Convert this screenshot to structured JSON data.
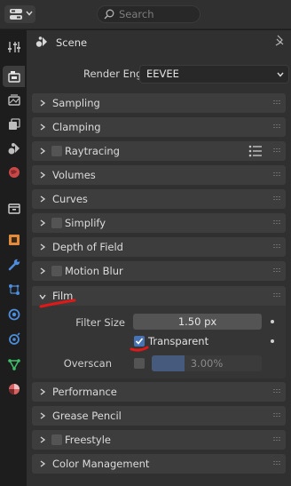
{
  "header": {
    "search_placeholder": "Search"
  },
  "tabs": [
    {
      "icon": "tool-icon",
      "active": false
    },
    {
      "icon": "render-icon",
      "active": true
    },
    {
      "icon": "output-icon",
      "active": false
    },
    {
      "icon": "view-layer-icon",
      "active": false
    },
    {
      "icon": "scene-icon",
      "active": false
    },
    {
      "icon": "world-icon",
      "active": false
    },
    {
      "icon": "collection-icon",
      "active": false
    },
    {
      "icon": "object-icon",
      "active": false
    },
    {
      "icon": "modifier-icon",
      "active": false
    },
    {
      "icon": "particles-icon",
      "active": false
    },
    {
      "icon": "physics-icon",
      "active": false
    },
    {
      "icon": "constraints-icon",
      "active": false
    },
    {
      "icon": "data-icon",
      "active": false
    },
    {
      "icon": "material-icon",
      "active": false
    }
  ],
  "context": {
    "title": "Scene"
  },
  "render_engine": {
    "label": "Render Engine",
    "value": "EEVEE"
  },
  "panels_top": [
    {
      "label": "Sampling",
      "has_checkbox": false
    },
    {
      "label": "Clamping",
      "has_checkbox": false
    },
    {
      "label": "Raytracing",
      "has_checkbox": true
    },
    {
      "label": "Volumes",
      "has_checkbox": false
    },
    {
      "label": "Curves",
      "has_checkbox": false
    },
    {
      "label": "Simplify",
      "has_checkbox": true
    },
    {
      "label": "Depth of Field",
      "has_checkbox": false
    },
    {
      "label": "Motion Blur",
      "has_checkbox": true
    }
  ],
  "film": {
    "label": "Film",
    "filter_size_label": "Filter Size",
    "filter_size_value": "1.50 px",
    "transparent_label": "Transparent",
    "transparent_checked": true,
    "overscan_label": "Overscan",
    "overscan_checked": false,
    "overscan_value": "3.00%",
    "overscan_fill_fraction": 0.3
  },
  "panels_bottom": [
    {
      "label": "Performance",
      "has_checkbox": false
    },
    {
      "label": "Grease Pencil",
      "has_checkbox": false
    },
    {
      "label": "Freestyle",
      "has_checkbox": true
    },
    {
      "label": "Color Management",
      "has_checkbox": false
    }
  ],
  "colors": {
    "accent": "#4772b3",
    "annotation_red": "#e01818"
  }
}
